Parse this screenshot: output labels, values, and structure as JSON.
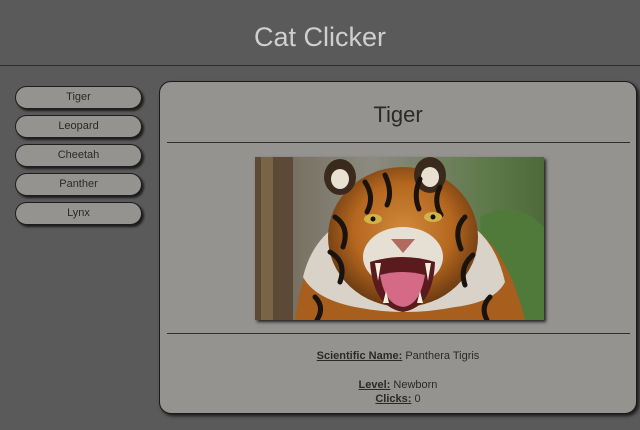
{
  "header": {
    "title": "Cat Clicker"
  },
  "sidebar": {
    "items": [
      {
        "label": "Tiger"
      },
      {
        "label": "Leopard"
      },
      {
        "label": "Cheetah"
      },
      {
        "label": "Panther"
      },
      {
        "label": "Lynx"
      }
    ]
  },
  "detail": {
    "name": "Tiger",
    "scientific_label": "Scientific Name:",
    "scientific_value": "Panthera Tigris",
    "level_label": "Level:",
    "level_value": "Newborn",
    "clicks_label": "Clicks:",
    "clicks_value": "0"
  },
  "colors": {
    "background": "#5a5a5a",
    "panel": "#949390",
    "title_text": "#cfcfcf"
  }
}
